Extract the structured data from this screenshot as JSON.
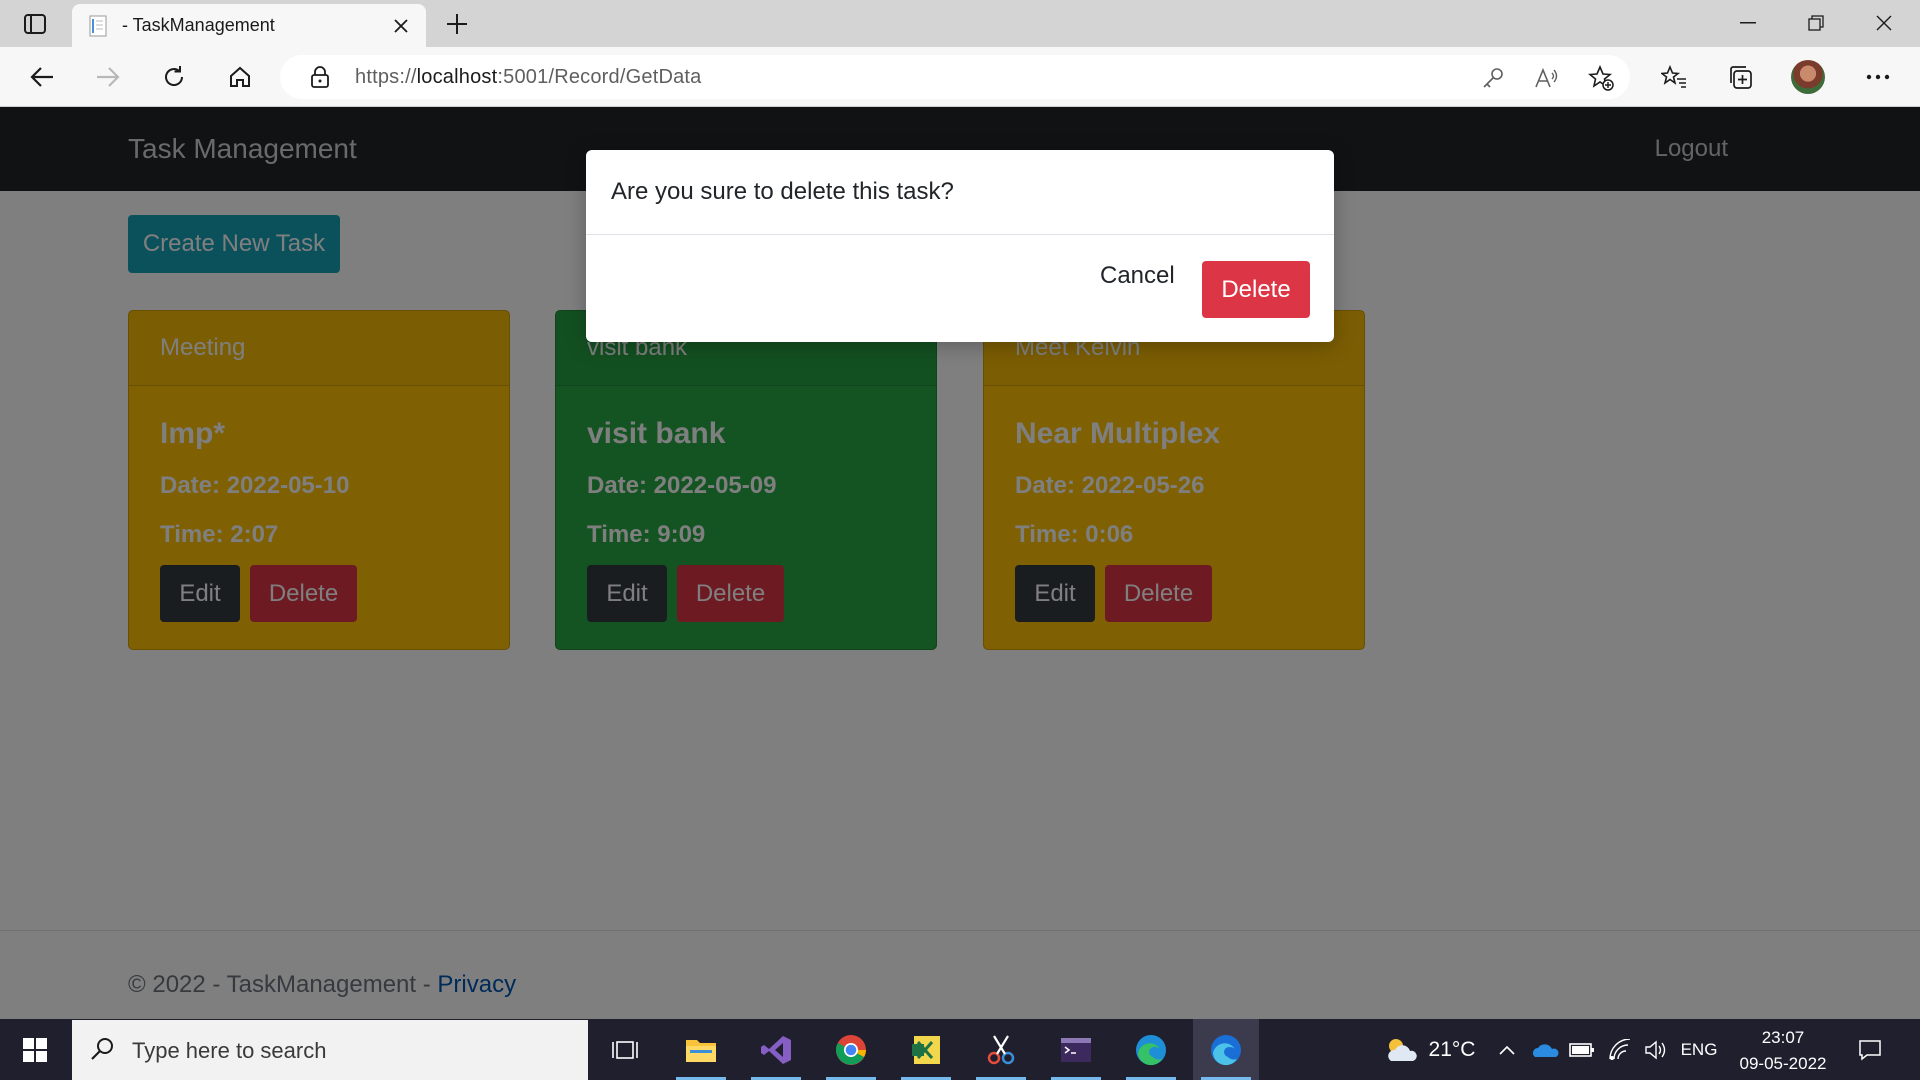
{
  "browser": {
    "tab_title": "- TaskManagement",
    "url_prefix": "https://",
    "url_host": "localhost",
    "url_rest": ":5001/Record/GetData"
  },
  "navbar": {
    "brand": "Task Management",
    "logout": "Logout"
  },
  "create_button": "Create New Task",
  "tasks": [
    {
      "header": "Meeting",
      "title": "Imp*",
      "date": "Date: 2022-05-10",
      "time": "Time: 2:07",
      "edit": "Edit",
      "delete": "Delete",
      "color": "#ffc107"
    },
    {
      "header": "visit bank",
      "title": "visit bank",
      "date": "Date: 2022-05-09",
      "time": "Time: 9:09",
      "edit": "Edit",
      "delete": "Delete",
      "color": "#28a745"
    },
    {
      "header": "Meet Kelvin",
      "title": "Near Multiplex",
      "date": "Date: 2022-05-26",
      "time": "Time: 0:06",
      "edit": "Edit",
      "delete": "Delete",
      "color": "#ffc107"
    }
  ],
  "modal": {
    "message": "Are you sure to delete this task?",
    "cancel": "Cancel",
    "delete": "Delete"
  },
  "footer": {
    "text": "© 2022 - TaskManagement - ",
    "link": "Privacy"
  },
  "taskbar": {
    "search_placeholder": "Type here to search",
    "weather": "21°C",
    "language": "ENG",
    "time": "23:07",
    "date": "09-05-2022",
    "apps": [
      "task-view-icon",
      "file-explorer-icon",
      "visual-studio-icon",
      "chrome-icon",
      "excel-icon",
      "snipping-tool-icon",
      "terminal-icon",
      "edge-icon",
      "edge-dev-icon"
    ]
  },
  "colors": {
    "navbar": "#212529",
    "primary_info": "#17a2b8",
    "danger": "#dc3545",
    "dark": "#343a40",
    "warning": "#ffc107",
    "success": "#28a745"
  }
}
